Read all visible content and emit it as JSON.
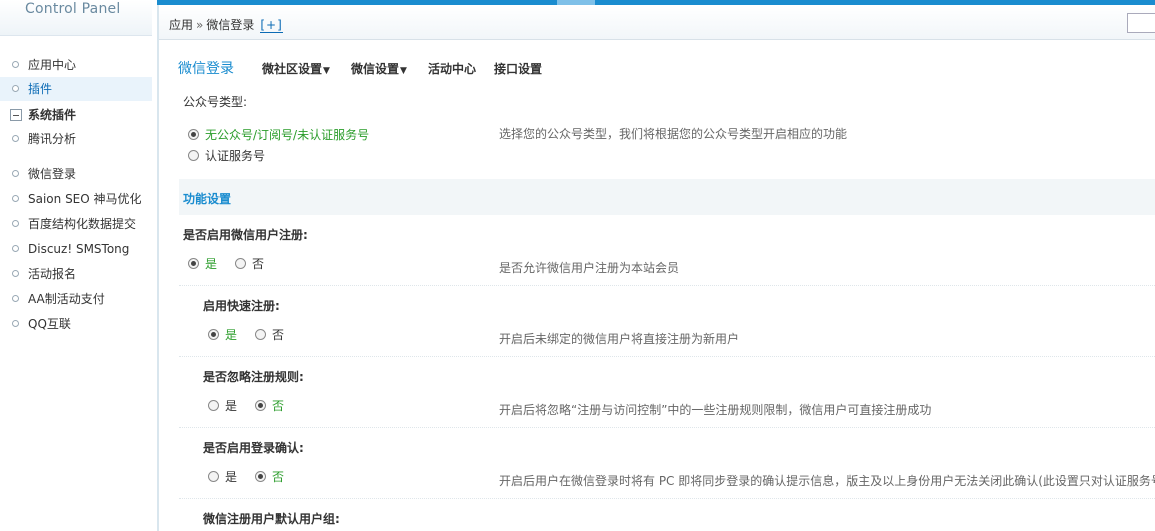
{
  "sidebar": {
    "logo": "Control Panel",
    "items": [
      {
        "label": "应用中心"
      },
      {
        "label": "插件"
      },
      {
        "label": "系统插件"
      },
      {
        "label": "腾讯分析"
      },
      {
        "label": "微信登录"
      },
      {
        "label": "Saion SEO 神马优化"
      },
      {
        "label": "百度结构化数据提交"
      },
      {
        "label": "Discuz! SMSTong"
      },
      {
        "label": "活动报名"
      },
      {
        "label": "AA制活动支付"
      },
      {
        "label": "QQ互联"
      }
    ]
  },
  "breadcrumb": {
    "root": "应用",
    "separator": "»",
    "current": "微信登录",
    "add": "[+]"
  },
  "nav": {
    "title": "微信登录",
    "items": [
      {
        "label": "微社区设置",
        "caret": "▼"
      },
      {
        "label": "微信设置",
        "caret": "▼"
      },
      {
        "label": "活动中心",
        "caret": ""
      },
      {
        "label": "接口设置",
        "caret": ""
      }
    ]
  },
  "account_type": {
    "label": "公众号类型:",
    "options": [
      "无公众号/订阅号/未认证服务号",
      "认证服务号"
    ],
    "selected": 0,
    "hint": "选择您的公众号类型，我们将根据您的公众号类型开启相应的功能"
  },
  "section": {
    "title": "功能设置"
  },
  "settings": [
    {
      "label": "是否启用微信用户注册:",
      "yes": "是",
      "no": "否",
      "selected": "yes",
      "hint": "是否允许微信用户注册为本站会员"
    },
    {
      "label": "启用快速注册:",
      "yes": "是",
      "no": "否",
      "selected": "yes",
      "hint": "开启后未绑定的微信用户将直接注册为新用户"
    },
    {
      "label": "是否忽略注册规则:",
      "yes": "是",
      "no": "否",
      "selected": "no",
      "hint": "开启后将忽略“注册与访问控制”中的一些注册规则限制，微信用户可直接注册成功"
    },
    {
      "label": "是否启用登录确认:",
      "yes": "是",
      "no": "否",
      "selected": "no",
      "hint": "开启后用户在微信登录时将有 PC 即将同步登录的确认提示信息，版主及以上身份用户无法关闭此确认(此设置只对认证服务号"
    },
    {
      "label": "微信注册用户默认用户组:"
    }
  ],
  "colors": {
    "accent": "#1a8ccf",
    "selected_option": "#2a9c2a",
    "sidebar_active_bg": "#e9f3fb"
  }
}
